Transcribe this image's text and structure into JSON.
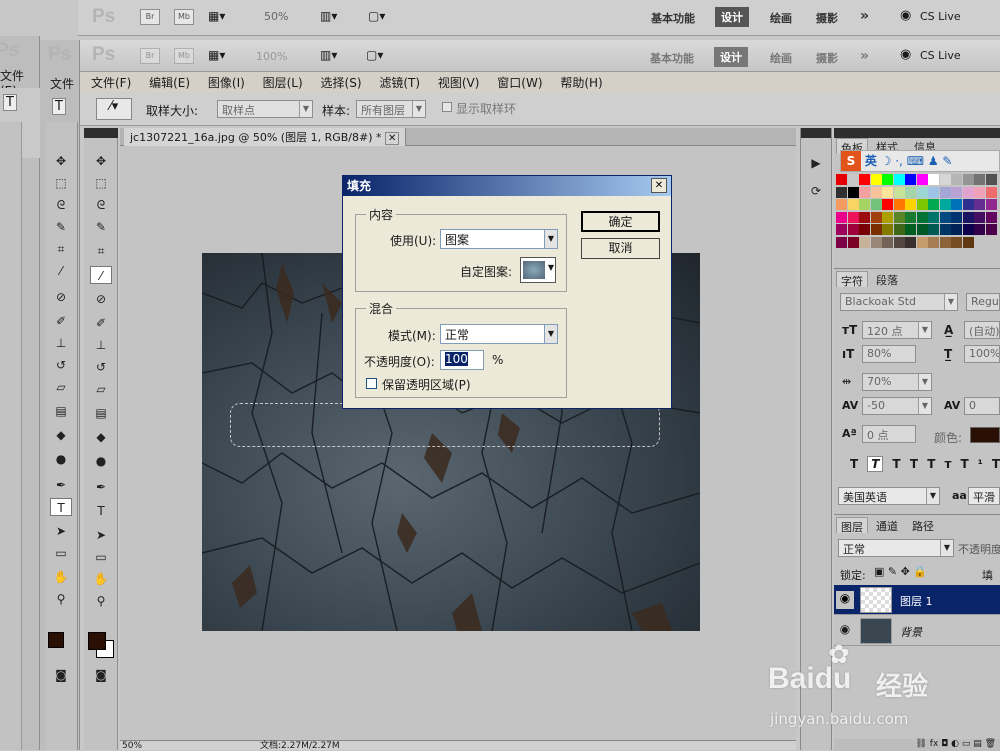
{
  "windows": {
    "back": {
      "logo": "Ps",
      "zoom": "50%",
      "workspace_basic": "基本功能",
      "workspace_design": "设计",
      "workspace_paint": "绘画",
      "workspace_photo": "摄影",
      "more": "»",
      "cslive": "CS Live"
    },
    "front": {
      "logo": "Ps",
      "zoom": "100%",
      "workspace_basic": "基本功能",
      "workspace_design": "设计",
      "workspace_paint": "绘画",
      "workspace_photo": "摄影",
      "more": "»",
      "cslive": "CS Live"
    }
  },
  "app_icons": {
    "br": "Br",
    "mb": "Mb"
  },
  "left_partial": {
    "logo": "Ps",
    "menu_file": "文件(E)",
    "menu_file2": "文件"
  },
  "menu": [
    "文件(F)",
    "编辑(E)",
    "图像(I)",
    "图层(L)",
    "选择(S)",
    "滤镜(T)",
    "视图(V)",
    "窗口(W)",
    "帮助(H)"
  ],
  "options": {
    "sample_size_label": "取样大小:",
    "sample_size_value": "取样点",
    "sample_label": "样本:",
    "sample_value": "所有图层",
    "ring_label": "显示取样环"
  },
  "document": {
    "tab_title": "jc1307221_16a.jpg @ 50% (图层 1, RGB/8#) *",
    "zoom_status": "50%",
    "doc_status": "文档:2.27M/2.27M",
    "small_tab": "jc"
  },
  "fill_dialog": {
    "title": "填充",
    "content_group": "内容",
    "use_label": "使用(U):",
    "use_value": "图案",
    "custom_pattern_label": "自定图案:",
    "blend_group": "混合",
    "mode_label": "模式(M):",
    "mode_value": "正常",
    "opacity_label": "不透明度(O):",
    "opacity_value": "100",
    "opacity_unit": "%",
    "preserve_label": "保留透明区域(P)",
    "ok": "确定",
    "cancel": "取消"
  },
  "swatches_panel": {
    "tabs": [
      "色板",
      "样式",
      "信息"
    ],
    "ime": "英"
  },
  "colors": [
    "#e60000",
    "#c8c8c8",
    "#ff0000",
    "#ffff00",
    "#00ff00",
    "#00ffff",
    "#0000ff",
    "#ff00ff",
    "#ffffff",
    "#d6d6d6",
    "#b5b5b5",
    "#949494",
    "#737373",
    "#525252",
    "#313131",
    "#000000",
    "#f2a0a0",
    "#f7c49a",
    "#fbe59a",
    "#c6e29b",
    "#a4d4a7",
    "#9bd6d2",
    "#9dc3e7",
    "#a3a6d6",
    "#b9a2d4",
    "#e2a3d0",
    "#f0a1b8",
    "#ee6c6c",
    "#f49b62",
    "#f8d462",
    "#a7d363",
    "#72c27c",
    "#ff0000",
    "#ff7700",
    "#ffd200",
    "#7bc600",
    "#00a84f",
    "#00a99d",
    "#0072bc",
    "#2e3192",
    "#662d91",
    "#92278f",
    "#ec008c",
    "#ed145b",
    "#9e0b0f",
    "#a0410d",
    "#aba000",
    "#598527",
    "#197b30",
    "#007236",
    "#00746b",
    "#004a80",
    "#003471",
    "#1b1464",
    "#440e62",
    "#630460",
    "#9e005d",
    "#9e0039",
    "#790000",
    "#7b2e00",
    "#827b00",
    "#406618",
    "#005e20",
    "#005826",
    "#005952",
    "#003663",
    "#002157",
    "#0d004c",
    "#32004b",
    "#4b0049",
    "#7b0046",
    "#7a0026",
    "#c7b299",
    "#998675",
    "#736357",
    "#534741",
    "#37302d",
    "#c69c6d",
    "#a67c52",
    "#8c6239",
    "#754c24",
    "#603913"
  ],
  "char_panel": {
    "tabs": [
      "字符",
      "段落"
    ],
    "font": "Blackoak Std",
    "style": "Regula",
    "size": "120 点",
    "leading": "(自动)",
    "vscale": "80%",
    "hscale": "100%",
    "tracking_pct": "70%",
    "kerning": "-50",
    "tracking": "0",
    "baseline": "0 点",
    "color_label": "颜色:",
    "lang": "美国英语",
    "aa": "平滑",
    "aa_icon": "aa"
  },
  "layers_panel": {
    "tabs": [
      "图层",
      "通道",
      "路径"
    ],
    "blend": "正常",
    "opacity_label": "不透明度",
    "lock_label": "锁定:",
    "fill_label": "填充",
    "layers": [
      {
        "name": "图层 1",
        "selected": true
      },
      {
        "name": "背景",
        "selected": false
      }
    ]
  },
  "watermark": {
    "brand": "Baidu",
    "cn": "经验",
    "url": "jingyan.baidu.com"
  }
}
